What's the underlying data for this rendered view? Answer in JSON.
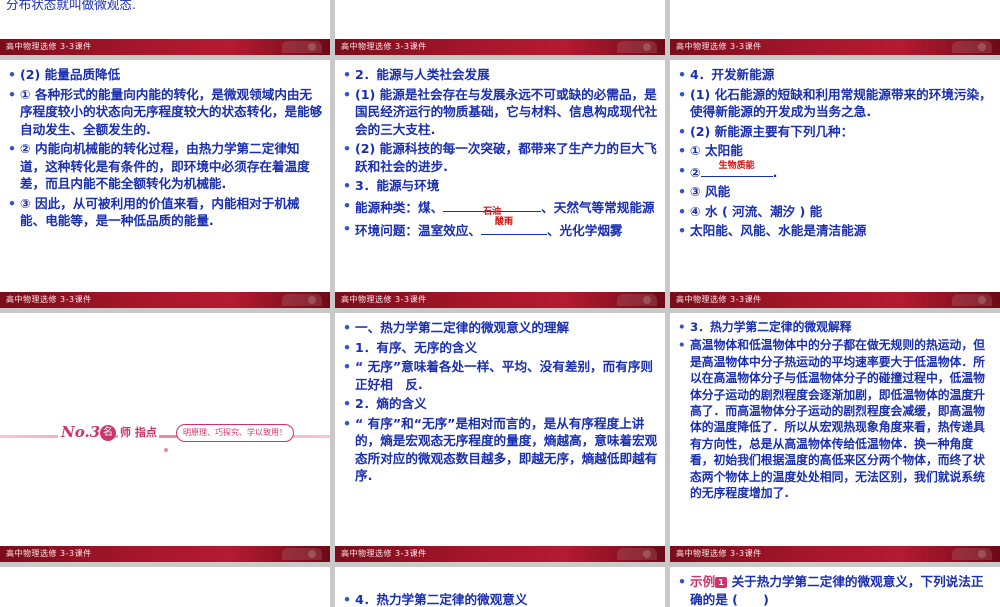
{
  "footer_text": "高中物理选修 3-3课件",
  "slide_r0c0": {
    "fragment": "分布状态就叫做微观态."
  },
  "slide_r1c0": {
    "items": [
      "(2) 能量品质降低",
      "① 各种形式的能量向内能的转化，是微观领域内由无序程度较小的状态向无序程度较大的状态转化，是能够自动发生、全额发生的.",
      "② 内能向机械能的转化过程，由热力学第二定律知道，这种转化是有条件的，即环境中必须存在着温度差，而且内能不能全额转化为机械能.",
      "③ 因此，从可被利用的价值来看，内能相对于机械能、电能等，是一种低品质的能量."
    ]
  },
  "slide_r1c1": {
    "item1": "2．能源与人类社会发展",
    "item2": "(1) 能源是社会存在与发展永远不可或缺的必需品，是国民经济运行的物质基础，它与材料、信息构成现代社会的三大支柱.",
    "item3": "(2) 能源科技的每一次突破，都带来了生产力的巨大飞跃和社会的进步.",
    "item4": "3．能源与环境",
    "item5_before": "能源种类：煤、",
    "item5_answer": "石油",
    "item5_after": "、天然气等常规能源",
    "item6_before": "环境问题：温室效应、",
    "item6_answer": "酸雨",
    "item6_after": "、光化学烟雾"
  },
  "slide_r1c2": {
    "item1": "4．开发新能源",
    "item2": "(1) 化石能源的短缺和利用常规能源带来的环境污染，使得新能源的开发成为当务之急.",
    "item3": "(2) 新能源主要有下列几种：",
    "item4": "① 太阳能",
    "item5_before": "②",
    "item5_answer": "生物质能",
    "item5_after": ".",
    "item6": "③ 风能",
    "item7": "④ 水 ( 河流、潮汐 ) 能",
    "item8": "太阳能、风能、水能是清洁能源"
  },
  "slide_r2c0": {
    "banner_no": "No.3",
    "banner_num": "名",
    "banner_title": "师 指点",
    "banner_tag": "明原理、巧探究、学以致用！"
  },
  "slide_r2c1": {
    "items": [
      "一、热力学第二定律的微观意义的理解",
      "1．有序、无序的含义",
      "“ 无序”意味着各处一样、平均、没有差别，而有序则正好相　反.",
      "2．熵的含义",
      "“ 有序”和“无序”是相对而言的，是从有序程度上讲的，熵是宏观态无序程度的量度，熵越高，意味着宏观态所对应的微观态数目越多，即越无序，熵越低即越有序."
    ]
  },
  "slide_r2c2": {
    "item1": "3．热力学第二定律的微观解释",
    "item2": "高温物体和低温物体中的分子都在做无规则的热运动，但是高温物体中分子热运动的平均速率要大于低温物体．所以在高温物体分子与低温物体分子的碰撞过程中，低温物体分子运动的剧烈程度会逐渐加剧，即低温物体的温度升高了．而高温物体分子运动的剧烈程度会减缓，即高温物体的温度降低了．所以从宏观热现象角度来看，热传递具有方向性，总是从高温物体传给低温物体．换一种角度看，初始我们根据温度的高低来区分两个物体，而终了状态两个物体上的温度处处相同，无法区别，我们就说系统的无序程度增加了."
  },
  "slide_r3c1": {
    "fragment": "4．热力学第二定律的微观意义"
  },
  "slide_r3c2": {
    "example_label": "示例",
    "example_num": "1",
    "fragment": "关于热力学第二定律的微观意义，下列说法正确的是 (　　)"
  }
}
